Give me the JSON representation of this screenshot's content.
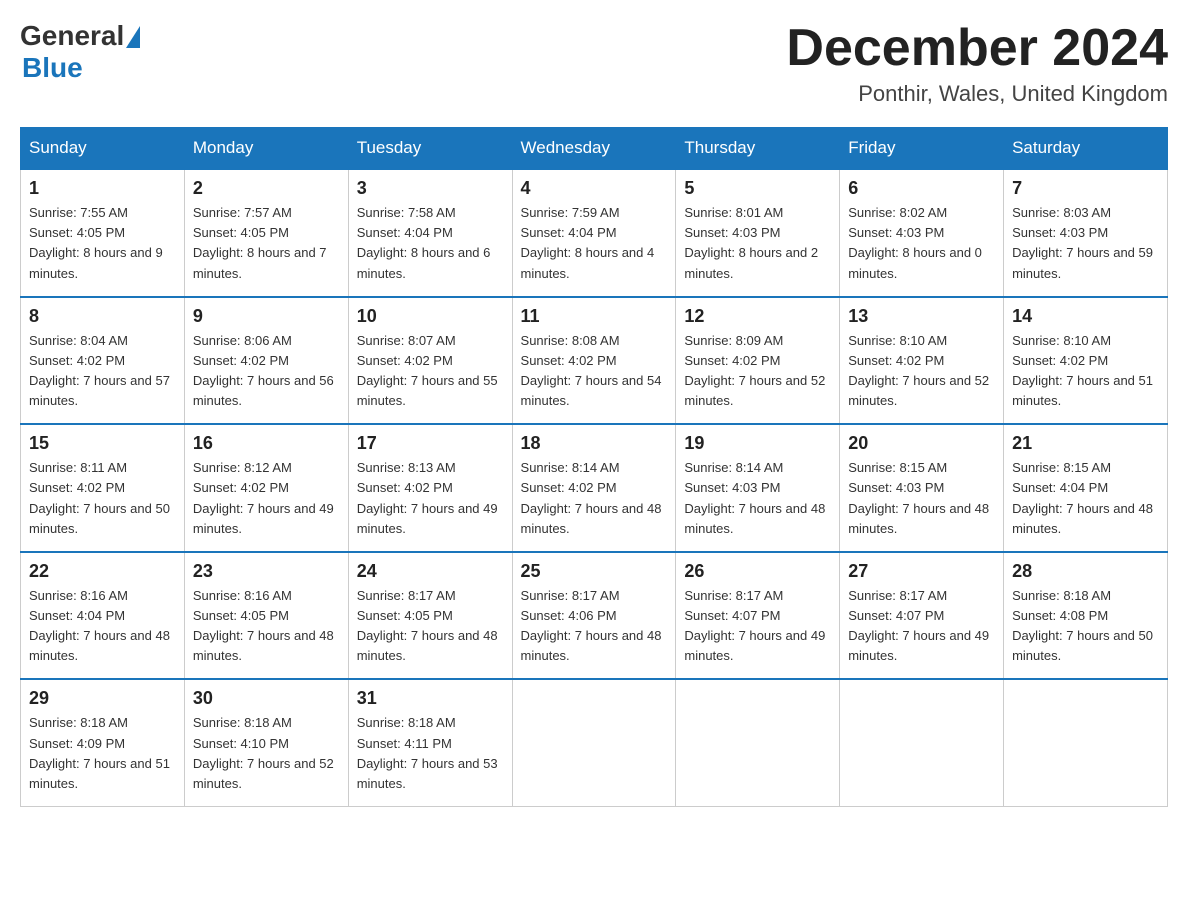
{
  "header": {
    "logo_general": "General",
    "logo_blue": "Blue",
    "month_title": "December 2024",
    "location": "Ponthir, Wales, United Kingdom"
  },
  "weekdays": [
    "Sunday",
    "Monday",
    "Tuesday",
    "Wednesday",
    "Thursday",
    "Friday",
    "Saturday"
  ],
  "weeks": [
    [
      {
        "day": "1",
        "sunrise": "7:55 AM",
        "sunset": "4:05 PM",
        "daylight": "8 hours and 9 minutes."
      },
      {
        "day": "2",
        "sunrise": "7:57 AM",
        "sunset": "4:05 PM",
        "daylight": "8 hours and 7 minutes."
      },
      {
        "day": "3",
        "sunrise": "7:58 AM",
        "sunset": "4:04 PM",
        "daylight": "8 hours and 6 minutes."
      },
      {
        "day": "4",
        "sunrise": "7:59 AM",
        "sunset": "4:04 PM",
        "daylight": "8 hours and 4 minutes."
      },
      {
        "day": "5",
        "sunrise": "8:01 AM",
        "sunset": "4:03 PM",
        "daylight": "8 hours and 2 minutes."
      },
      {
        "day": "6",
        "sunrise": "8:02 AM",
        "sunset": "4:03 PM",
        "daylight": "8 hours and 0 minutes."
      },
      {
        "day": "7",
        "sunrise": "8:03 AM",
        "sunset": "4:03 PM",
        "daylight": "7 hours and 59 minutes."
      }
    ],
    [
      {
        "day": "8",
        "sunrise": "8:04 AM",
        "sunset": "4:02 PM",
        "daylight": "7 hours and 57 minutes."
      },
      {
        "day": "9",
        "sunrise": "8:06 AM",
        "sunset": "4:02 PM",
        "daylight": "7 hours and 56 minutes."
      },
      {
        "day": "10",
        "sunrise": "8:07 AM",
        "sunset": "4:02 PM",
        "daylight": "7 hours and 55 minutes."
      },
      {
        "day": "11",
        "sunrise": "8:08 AM",
        "sunset": "4:02 PM",
        "daylight": "7 hours and 54 minutes."
      },
      {
        "day": "12",
        "sunrise": "8:09 AM",
        "sunset": "4:02 PM",
        "daylight": "7 hours and 52 minutes."
      },
      {
        "day": "13",
        "sunrise": "8:10 AM",
        "sunset": "4:02 PM",
        "daylight": "7 hours and 52 minutes."
      },
      {
        "day": "14",
        "sunrise": "8:10 AM",
        "sunset": "4:02 PM",
        "daylight": "7 hours and 51 minutes."
      }
    ],
    [
      {
        "day": "15",
        "sunrise": "8:11 AM",
        "sunset": "4:02 PM",
        "daylight": "7 hours and 50 minutes."
      },
      {
        "day": "16",
        "sunrise": "8:12 AM",
        "sunset": "4:02 PM",
        "daylight": "7 hours and 49 minutes."
      },
      {
        "day": "17",
        "sunrise": "8:13 AM",
        "sunset": "4:02 PM",
        "daylight": "7 hours and 49 minutes."
      },
      {
        "day": "18",
        "sunrise": "8:14 AM",
        "sunset": "4:02 PM",
        "daylight": "7 hours and 48 minutes."
      },
      {
        "day": "19",
        "sunrise": "8:14 AM",
        "sunset": "4:03 PM",
        "daylight": "7 hours and 48 minutes."
      },
      {
        "day": "20",
        "sunrise": "8:15 AM",
        "sunset": "4:03 PM",
        "daylight": "7 hours and 48 minutes."
      },
      {
        "day": "21",
        "sunrise": "8:15 AM",
        "sunset": "4:04 PM",
        "daylight": "7 hours and 48 minutes."
      }
    ],
    [
      {
        "day": "22",
        "sunrise": "8:16 AM",
        "sunset": "4:04 PM",
        "daylight": "7 hours and 48 minutes."
      },
      {
        "day": "23",
        "sunrise": "8:16 AM",
        "sunset": "4:05 PM",
        "daylight": "7 hours and 48 minutes."
      },
      {
        "day": "24",
        "sunrise": "8:17 AM",
        "sunset": "4:05 PM",
        "daylight": "7 hours and 48 minutes."
      },
      {
        "day": "25",
        "sunrise": "8:17 AM",
        "sunset": "4:06 PM",
        "daylight": "7 hours and 48 minutes."
      },
      {
        "day": "26",
        "sunrise": "8:17 AM",
        "sunset": "4:07 PM",
        "daylight": "7 hours and 49 minutes."
      },
      {
        "day": "27",
        "sunrise": "8:17 AM",
        "sunset": "4:07 PM",
        "daylight": "7 hours and 49 minutes."
      },
      {
        "day": "28",
        "sunrise": "8:18 AM",
        "sunset": "4:08 PM",
        "daylight": "7 hours and 50 minutes."
      }
    ],
    [
      {
        "day": "29",
        "sunrise": "8:18 AM",
        "sunset": "4:09 PM",
        "daylight": "7 hours and 51 minutes."
      },
      {
        "day": "30",
        "sunrise": "8:18 AM",
        "sunset": "4:10 PM",
        "daylight": "7 hours and 52 minutes."
      },
      {
        "day": "31",
        "sunrise": "8:18 AM",
        "sunset": "4:11 PM",
        "daylight": "7 hours and 53 minutes."
      },
      null,
      null,
      null,
      null
    ]
  ]
}
